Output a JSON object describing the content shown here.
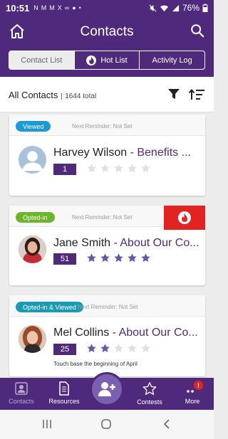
{
  "status_bar": {
    "time": "10:51",
    "notification_icons": [
      "N",
      "M",
      "M",
      "X",
      "∞",
      "●",
      "•"
    ],
    "battery": "76%"
  },
  "header": {
    "title": "Contacts"
  },
  "tabs": [
    {
      "label": "Contact List",
      "active": true
    },
    {
      "label": "Hot List",
      "active": false,
      "icon": "flame-icon"
    },
    {
      "label": "Activity Log",
      "active": false
    }
  ],
  "list": {
    "title": "All Contacts",
    "separator": "|",
    "total": "1644 total"
  },
  "contacts": [
    {
      "status": "Viewed",
      "status_color": "#1a9ad6",
      "reminder": "Next Reminder: Not Set",
      "name": "Harvey Wilson",
      "subject": " - Benefits ...",
      "score": "1",
      "rating": 0,
      "hot": false,
      "avatar": "default-avatar-icon"
    },
    {
      "status": "Opted-in",
      "status_color": "#6cb52d",
      "reminder": "Next Reminder: Not Set",
      "name": "Jane Smith",
      "subject": " - About Our Co...",
      "score": "51",
      "rating": 5,
      "hot": true,
      "avatar": "photo"
    },
    {
      "status": "Opted-in & Viewed",
      "status_color": "#1a9bb3",
      "reminder": "Next Reminder: Not Set",
      "name": "Mel Collins",
      "subject": " - About Our Co...",
      "score": "25",
      "rating": 2,
      "hot": false,
      "avatar": "photo",
      "note": "Touch base the beginning of April"
    }
  ],
  "bottom_nav": [
    {
      "label": "Contacts",
      "icon": "contact-card-icon",
      "active": true
    },
    {
      "label": "Resources",
      "icon": "document-icon",
      "active": false
    },
    {
      "label": "",
      "icon": "add-person-icon",
      "active": false
    },
    {
      "label": "Contests",
      "icon": "star-outline-icon",
      "active": false
    },
    {
      "label": "More",
      "icon": "more-dots-icon",
      "active": false,
      "badge": "!"
    }
  ],
  "colors": {
    "brand_purple": "#4f2a7c",
    "star_filled": "#6a55a8",
    "star_empty": "#e0e0e0",
    "hot_red": "#e32222"
  }
}
